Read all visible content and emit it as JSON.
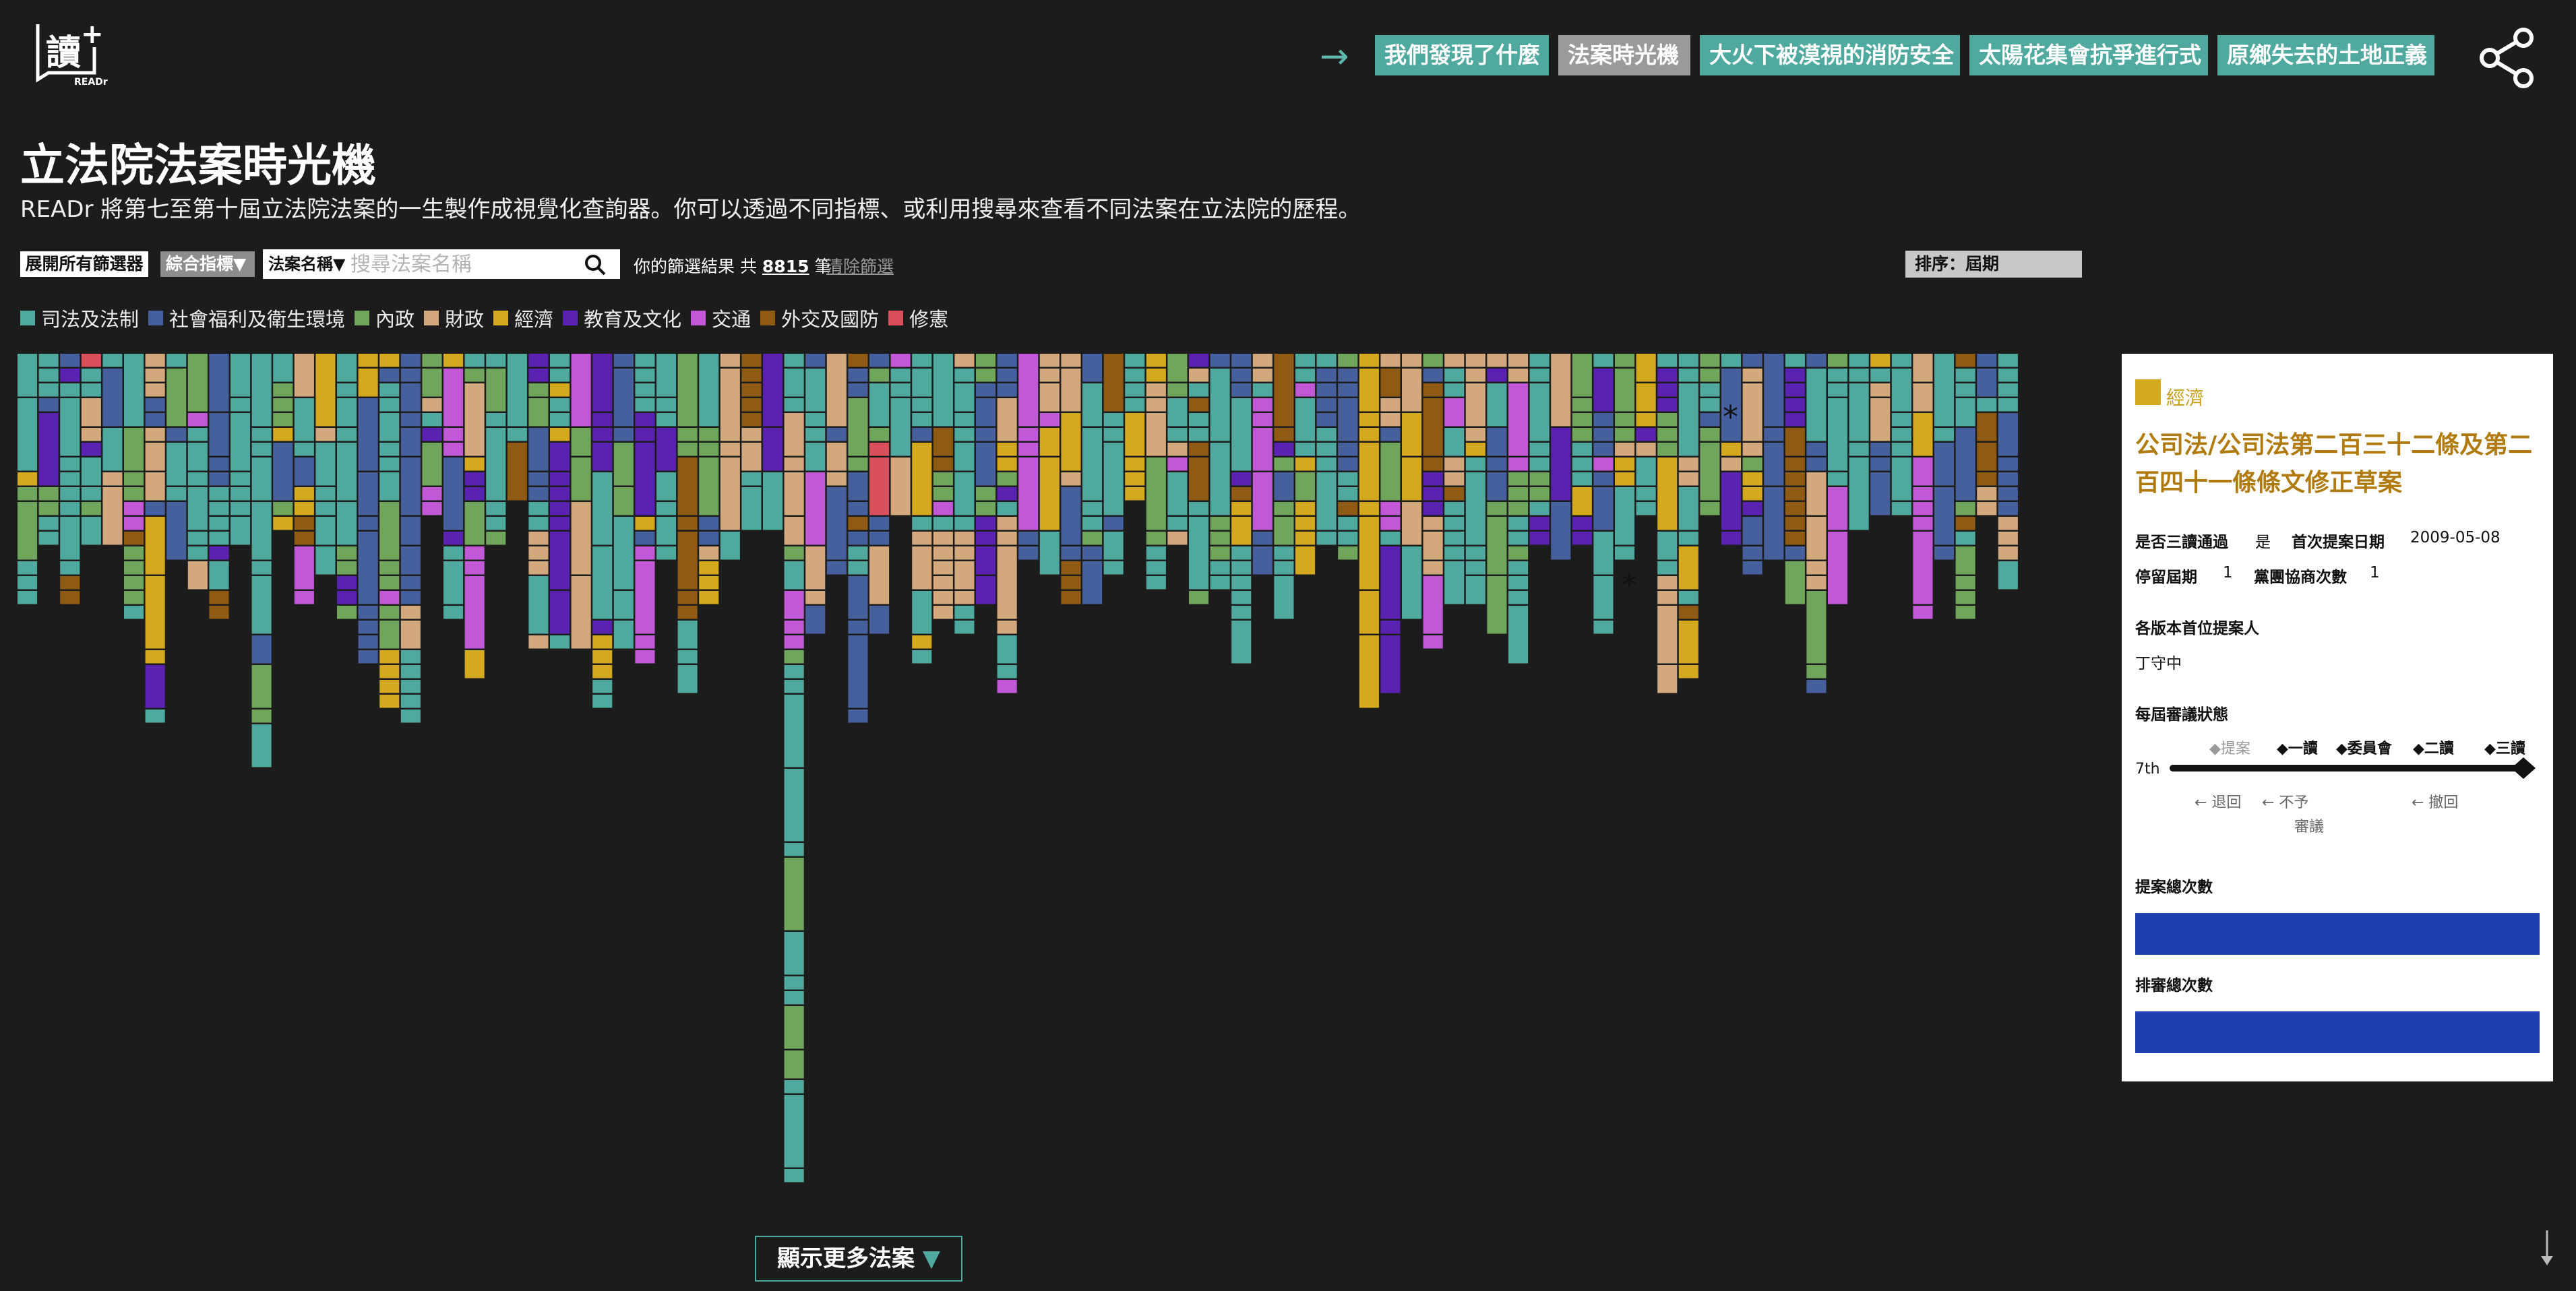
{
  "header": {
    "logo_text": "讀+",
    "logo_sub": "READr",
    "nav": [
      {
        "label": "我們發現了什麼",
        "active": false
      },
      {
        "label": "法案時光機",
        "active": true
      },
      {
        "label": "大火下被漠視的消防安全",
        "active": false
      },
      {
        "label": "太陽花集會抗爭進行式",
        "active": false
      },
      {
        "label": "原鄉失去的土地正義",
        "active": false
      }
    ],
    "share_icon": "share-icon",
    "arrow_icon": "arrow-right-icon"
  },
  "page": {
    "title": "立法院法案時光機",
    "subtitle": "READr 將第七至第十屆立法院法案的一生製作成視覺化查詢器。你可以透過不同指標、或利用搜尋來查看不同法案在立法院的歷程。"
  },
  "filters": {
    "expand_all": "展開所有篩選器",
    "metric_select": "綜合指標▼",
    "search_type": "法案名稱▼",
    "search_placeholder": "搜尋法案名稱",
    "search_icon": "search-icon",
    "result_prefix": "你的篩選結果 共",
    "result_count": "8815",
    "result_suffix": "筆",
    "clear": "清除篩選",
    "sort": "排序：屆期"
  },
  "legend": [
    {
      "label": "司法及法制",
      "color": "#4fa99f"
    },
    {
      "label": "社會福利及衛生環境",
      "color": "#46609e"
    },
    {
      "label": "內政",
      "color": "#6fa65c"
    },
    {
      "label": "財政",
      "color": "#d2a87c"
    },
    {
      "label": "經濟",
      "color": "#d4a91e"
    },
    {
      "label": "教育及文化",
      "color": "#5a22b0"
    },
    {
      "label": "交通",
      "color": "#c158d6"
    },
    {
      "label": "外交及國防",
      "color": "#8f5a14"
    },
    {
      "label": "修憲",
      "color": "#d9505c"
    }
  ],
  "detail": {
    "category": "經濟",
    "category_color": "#d4a91e",
    "title": "公司法/公司法第二百三十二條及第二百四十一條條文修正草案",
    "third_reading_label": "是否三讀通過",
    "third_reading_value": "是",
    "first_date_label": "首次提案日期",
    "first_date_value": "2009-05-08",
    "term_count_label": "停留屆期",
    "term_count_value": "1",
    "negotiation_label": "黨團協商次數",
    "negotiation_value": "1",
    "proposer_label": "各版本首位提案人",
    "proposer_value": "丁守中",
    "status_label": "每屆審議狀態",
    "stages": [
      "◆提案",
      "◆一讀",
      "◆委員會",
      "◆二讀",
      "◆三讀"
    ],
    "term": "7th",
    "back_labels": [
      "← 退回",
      "← 不予",
      "審議",
      "← 撤回"
    ],
    "total_proposals_label": "提案總次數",
    "total_agenda_label": "排審總次數"
  },
  "footer": {
    "show_more": "顯示更多法案",
    "show_more_arrow": "▼",
    "scroll_icon": "scroll-down-icon"
  }
}
